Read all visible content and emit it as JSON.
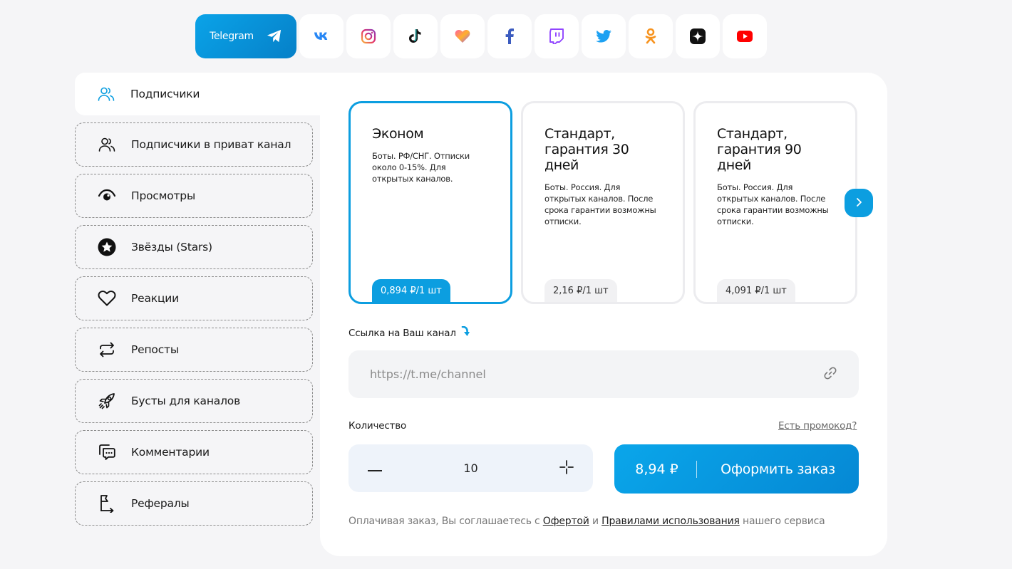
{
  "platforms": {
    "active_label": "Telegram",
    "items": [
      "telegram",
      "vk",
      "instagram",
      "tiktok",
      "likee",
      "facebook",
      "twitch",
      "twitter",
      "odnoklassniki",
      "dzen",
      "youtube"
    ]
  },
  "sidebar": {
    "items": [
      {
        "label": "Подписчики",
        "icon": "users-icon"
      },
      {
        "label": "Подписчики в приват канал",
        "icon": "users-icon"
      },
      {
        "label": "Просмотры",
        "icon": "eye-icon"
      },
      {
        "label": "Звёзды (Stars)",
        "icon": "star-icon"
      },
      {
        "label": "Реакции",
        "icon": "heart-icon"
      },
      {
        "label": "Репосты",
        "icon": "repost-icon"
      },
      {
        "label": "Бусты для каналов",
        "icon": "rocket-icon"
      },
      {
        "label": "Комментарии",
        "icon": "comments-icon"
      },
      {
        "label": "Рефералы",
        "icon": "flag-icon"
      }
    ]
  },
  "tariffs": [
    {
      "title": "Эконом",
      "description": "Боты. РФ/СНГ. Отписки около 0-15%. Для открытых каналов.",
      "price": "0,894 ₽/1 шт"
    },
    {
      "title": "Стандарт, гарантия 30 дней",
      "description": "Боты. Россия. Для открытых каналов. После срока гарантии возможны отписки.",
      "price": "2,16 ₽/1 шт"
    },
    {
      "title": "Стандарт, гарантия 90 дней",
      "description": "Боты. Россия. Для открытых каналов. После срока гарантии возможны отписки.",
      "price": "4,091 ₽/1 шт"
    }
  ],
  "form": {
    "link_label": "Ссылка на Ваш канал",
    "link_placeholder": "https://t.me/channel",
    "quantity_label": "Количество",
    "promo_label": "Есть промокод?",
    "quantity_value": "10",
    "total": "8,94 ₽",
    "order_label": "Оформить заказ"
  },
  "terms": {
    "prefix": "Оплачивая заказ, Вы соглашаетесь с",
    "offer_link": "Офертой",
    "and": "и",
    "rules_link": "Правилами использования",
    "suffix": "нашего сервиса"
  },
  "colors": {
    "accent": "#0c9ee0",
    "background": "#f5f5f7"
  }
}
